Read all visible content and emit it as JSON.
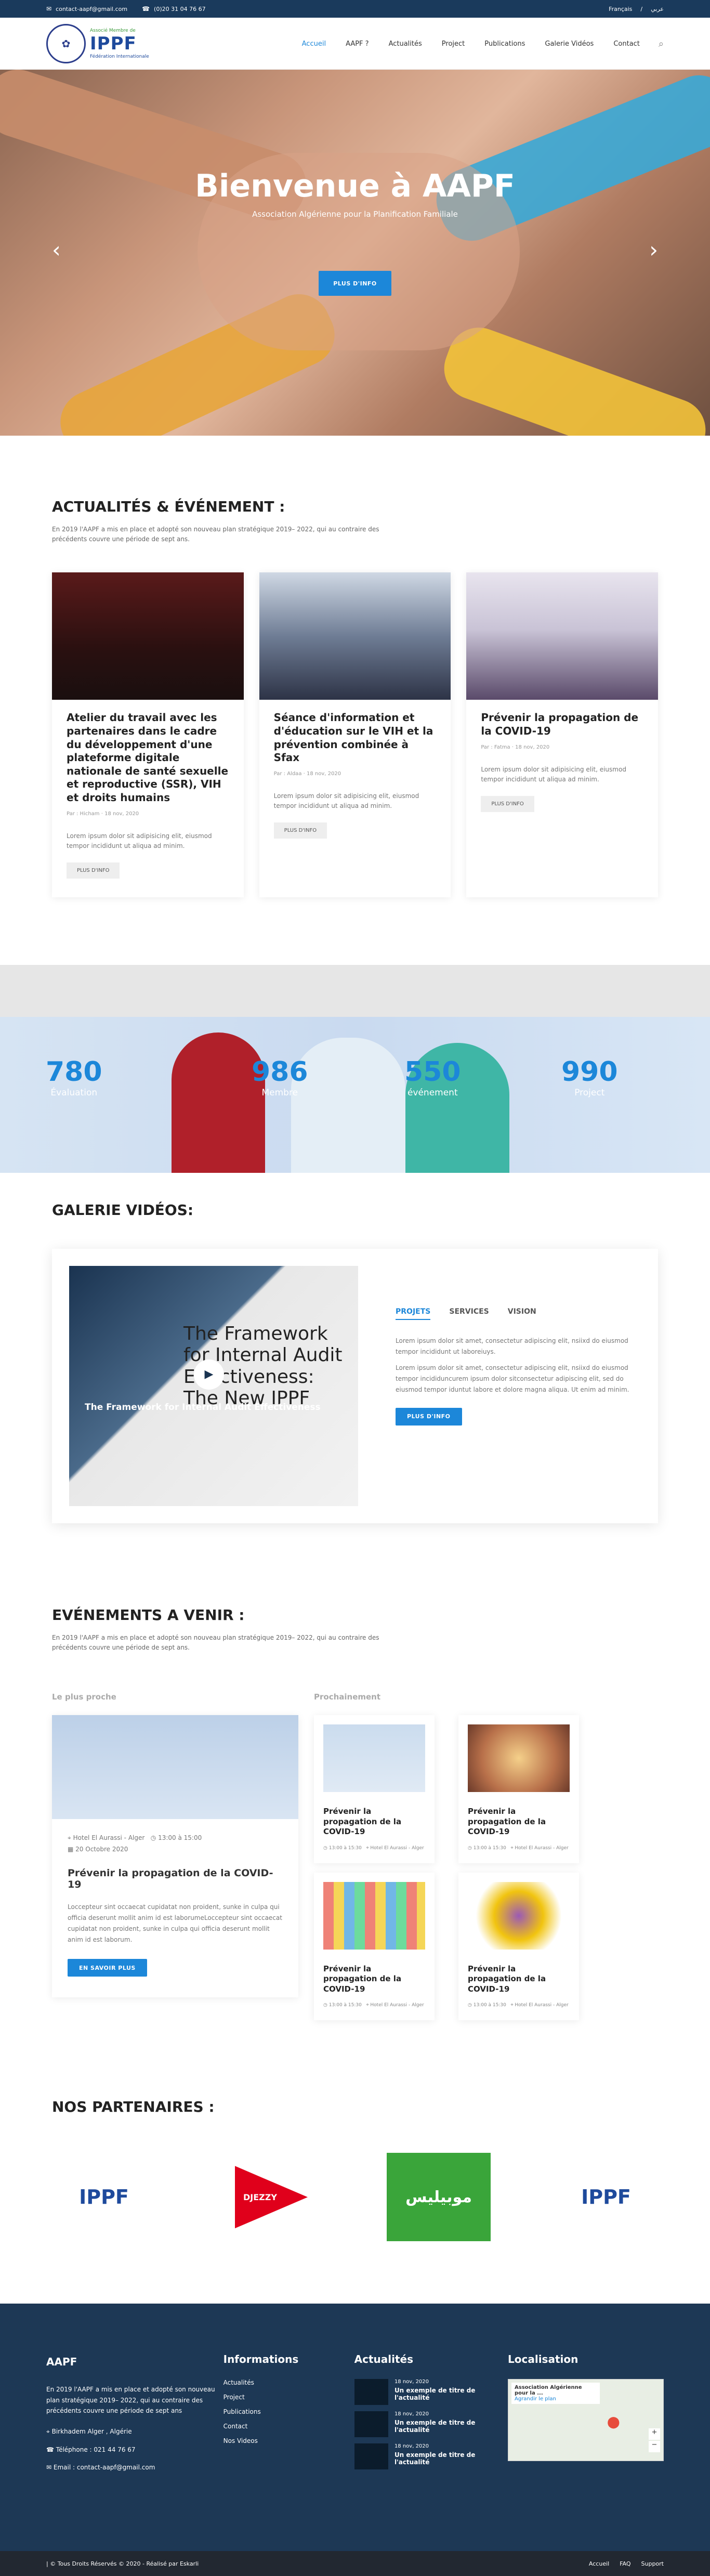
{
  "topbar": {
    "email": "contact-aapf@gmail.com",
    "phone": "(0)20 31 04 76 67",
    "lang_fr": "Français",
    "lang_ar": "عربي",
    "email_icon": "envelope-icon",
    "phone_icon": "phone-icon"
  },
  "logo": {
    "small": "Associé Membre de",
    "big": "IPPF",
    "sub": "Fédération Internationale"
  },
  "nav": [
    "Accueil",
    "AAPF ?",
    "Actualités",
    "Project",
    "Publications",
    "Galerie Vidéos",
    "Contact"
  ],
  "hero": {
    "title": "Bienvenue à AAPF",
    "subtitle": "Association Algérienne pour la Planification Familiale",
    "button": "PLUS D'INFO"
  },
  "news": {
    "title": "ACTUALITÉS & ÉVÉNEMENT :",
    "desc": "En 2019 l'AAPF a mis en place et adopté son nouveau plan stratégique 2019– 2022, qui au contraire des précédents couvre une période de sept ans.",
    "cards": [
      {
        "title": "Atelier du travail avec les partenaires dans le cadre du développement d'une plateforme digitale nationale de santé sexuelle et reproductive (SSR), VIH et droits humains",
        "meta": "Par : Hicham · 18 nov, 2020",
        "text": "Lorem ipsum dolor sit adipisicing elit, eiusmod tempor incididunt ut aliqua ad minim.",
        "button": "PLUS D'INFO"
      },
      {
        "title": "Séance d'information et d'éducation sur le VIH et la prévention combinée à Sfax",
        "meta": "Par : Aldaa · 18 nov, 2020",
        "text": "Lorem ipsum dolor sit adipisicing elit, eiusmod tempor incididunt ut aliqua ad minim.",
        "button": "PLUS D'INFO"
      },
      {
        "title": "Prévenir la propagation de la COVID-19",
        "meta": "Par : Fatma · 18 nov, 2020",
        "text": "Lorem ipsum dolor sit adipisicing elit, eiusmod tempor incididunt ut aliqua ad minim.",
        "button": "PLUS D'INFO"
      }
    ]
  },
  "stats": [
    {
      "num": "780",
      "label": "Évaluation"
    },
    {
      "num": "986",
      "label": "Membre"
    },
    {
      "num": "550",
      "label": "événement"
    },
    {
      "num": "990",
      "label": "Project"
    }
  ],
  "videos": {
    "title": "GALERIE VIDÉOS:",
    "caption": "The Framework for Internal Audit Effectiveness",
    "slide_text": "The Framework for Internal Audit Effectiveness: The New IPPF",
    "tabs": [
      "PROJETS",
      "SERVICES",
      "VISION"
    ],
    "p1": "Lorem ipsum dolor sit amet, consectetur adipiscing elit, nsiixd do eiusmod tempor incididunt ut laboreiuys.",
    "p2": "Lorem ipsum dolor sit amet, consectetur adipiscing elit, nsiixd do eiusmod tempor incididuncurem ipsum dolor sitconsectetur adipiscing elit, sed do eiusmod tempor iduntut labore et dolore magna aliqua. Ut enim ad minim.",
    "button": "PLUS D'INFO"
  },
  "upcoming": {
    "title": "EVÉNEMENTS A VENIR :",
    "desc": "En 2019 l'AAPF a mis en place et adopté son nouveau plan stratégique 2019– 2022, qui au contraire des précédents couvre une période de sept ans.",
    "label_near": "Le plus proche",
    "label_next": "Prochainement",
    "big": {
      "location": "Hotel El Aurassi - Alger",
      "time": "13:00 à 15:00",
      "date": "20 Octobre 2020",
      "title": "Prévenir la propagation de la COVID-19",
      "text": "Loccepteur sint occaecat cupidatat non proident, sunke in culpa qui officia deserunt mollit anim id est laborumeLoccepteur sint occaecat cupidatat non proident, sunke in culpa qui officia deserunt mollit anim id est laborum.",
      "button": "EN SAVOIR PLUS"
    },
    "small": [
      {
        "title": "Prévenir la propagation de la COVID-19",
        "time": "13:00 à 15:30",
        "loc": "Hotel El Aurassi - Alger"
      },
      {
        "title": "Prévenir la propagation de la COVID-19",
        "time": "13:00 à 15:30",
        "loc": "Hotel El Aurassi - Alger"
      },
      {
        "title": "Prévenir la propagation de la COVID-19",
        "time": "13:00 à 15:30",
        "loc": "Hotel El Aurassi - Alger"
      },
      {
        "title": "Prévenir la propagation de la COVID-19",
        "time": "13:00 à 15:30",
        "loc": "Hotel El Aurassi - Alger"
      }
    ]
  },
  "partners": {
    "title": "NOS PARTENAIRES :",
    "names": [
      "IPPF",
      "DJEZZY",
      "موبيليس",
      "IPPF"
    ]
  },
  "footer": {
    "c1_title": "AAPF",
    "c1_text": "En 2019 l'AAPF a mis en place et adopté son nouveau plan stratégique 2019– 2022, qui au contraire des précédents couvre une période de sept ans",
    "address": "Birkhadem Alger , Algérie",
    "phone": "Téléphone : 021 44 76 67",
    "email": "Email : contact-aapf@gmail.com",
    "c2_title": "Informations",
    "links": [
      "Actualités",
      "Project",
      "Publications",
      "Contact",
      "Nos Videos"
    ],
    "c3_title": "Actualités",
    "news": [
      {
        "date": "18 nov, 2020",
        "title": "Un exemple de titre de l'actualité"
      },
      {
        "date": "18 nov, 2020",
        "title": "Un exemple de titre de l'actualité"
      },
      {
        "date": "18 nov, 2020",
        "title": "Un exemple de titre de l'actualité"
      }
    ],
    "c4_title": "Localisation",
    "map_label": "Association Algérienne pour la ...",
    "map_link": "Agrandir le plan"
  },
  "bottom": {
    "copy": "| © Tous Droits Réservés © 2020 - Réalisé par Eskarli",
    "links": [
      "Accueil",
      "FAQ",
      "Support"
    ]
  }
}
